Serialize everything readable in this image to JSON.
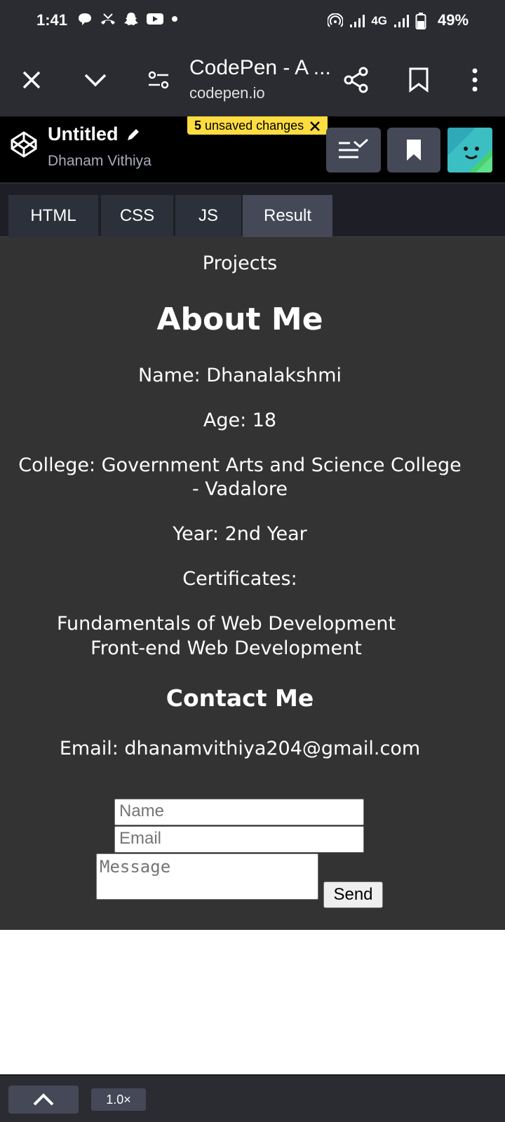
{
  "status": {
    "time": "1:41",
    "network": "4G",
    "battery": "49%"
  },
  "browser": {
    "title": "CodePen - A ...",
    "url": "codepen.io"
  },
  "codepen": {
    "pen_title": "Untitled",
    "author": "Dhanam Vithiya",
    "unsaved_count": "5",
    "unsaved_text": "unsaved changes"
  },
  "tabs": [
    {
      "label": "HTML"
    },
    {
      "label": "CSS"
    },
    {
      "label": "JS"
    },
    {
      "label": "Result"
    }
  ],
  "result": {
    "nav_link": "Projects",
    "about_heading": "About Me",
    "name": "Name: Dhanalakshmi",
    "age": "Age: 18",
    "college_line1": "College: Government Arts and Science College",
    "college_line2": "- Vadalore",
    "year": "Year: 2nd Year",
    "certificates_label": "Certificates:",
    "certificates": [
      "Fundamentals of Web Development",
      "Front-end Web Development"
    ],
    "contact_heading": "Contact Me",
    "email": "Email: dhanamvithiya204@gmail.com",
    "form": {
      "name_placeholder": "Name",
      "email_placeholder": "Email",
      "message_placeholder": "Message",
      "send_label": "Send"
    }
  },
  "bottom": {
    "zoom": "1.0×"
  },
  "colors": {
    "chrome_bg": "#2b2c31",
    "result_bg": "#333333",
    "unsaved_bg": "#ffdd40",
    "tab_active": "#444857"
  }
}
